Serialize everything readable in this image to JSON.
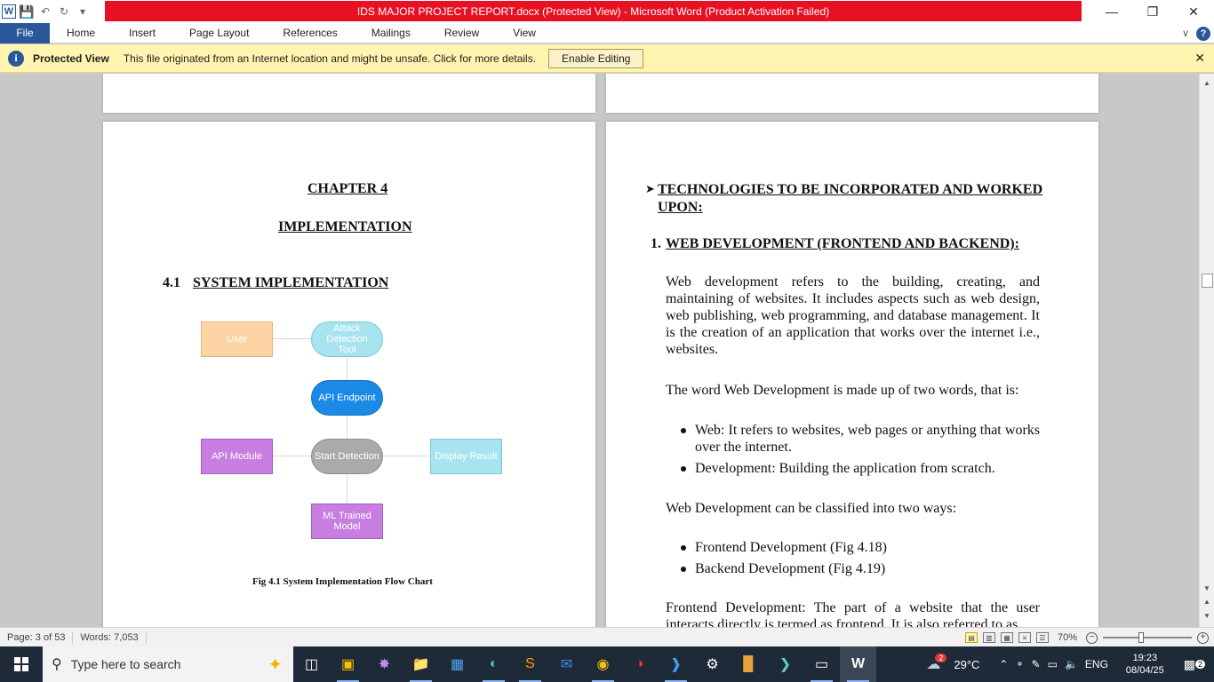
{
  "window": {
    "title": "IDS MAJOR PROJECT REPORT.docx (Protected View)  -  Microsoft Word (Product Activation Failed)"
  },
  "ribbon": {
    "tabs": [
      "File",
      "Home",
      "Insert",
      "Page Layout",
      "References",
      "Mailings",
      "Review",
      "View"
    ]
  },
  "protected_bar": {
    "label": "Protected View",
    "message": "This file originated from an Internet location and might be unsafe. Click for more details.",
    "button": "Enable Editing"
  },
  "page1": {
    "chapter": "CHAPTER 4",
    "title": "IMPLEMENTATION",
    "section_num": "4.1",
    "section_title": "SYSTEM IMPLEMENTATION",
    "flow": {
      "user": "User",
      "attack_tool": "Attack Detection Tool",
      "api_endpoint": "API Endpoint",
      "api_module": "API Module",
      "start_detection": "Start Detection",
      "display_result": "Display Result",
      "ml_model": "ML Trained Model"
    },
    "caption": "Fig 4.1 System Implementation Flow Chart"
  },
  "page2": {
    "heading": "TECHNOLOGIES TO BE INCORPORATED AND WORKED UPON:",
    "sub_num": "1.",
    "sub_heading": "WEB DEVELOPMENT (FRONTEND AND BACKEND):",
    "para1": "Web development refers to the building, creating, and maintaining of websites. It includes aspects such as web design, web publishing, web programming, and database management. It is the creation of an application that works over the internet i.e., websites.",
    "para2": "The word Web Development is made up of two words, that is:",
    "bullets1": [
      "Web: It refers to websites, web pages or anything that works over the internet.",
      "Development: Building the application from scratch."
    ],
    "para3": "Web Development can be classified into two ways:",
    "bullets2": [
      "Frontend Development (Fig 4.18)",
      "Backend Development (Fig 4.19)"
    ],
    "para4": "Frontend Development: The part of a website that the user interacts directly is termed as frontend. It is also referred to as"
  },
  "status": {
    "page": "Page: 3 of 53",
    "words": "Words: 7,053",
    "zoom": "70%"
  },
  "taskbar": {
    "search_placeholder": "Type here to search",
    "weather": "29°C",
    "weather_badge": "2",
    "lang": "ENG",
    "time": "19:23",
    "date": "08/04/25",
    "notif_count": "2"
  },
  "colors": {
    "title_red": "#e81123",
    "word_blue": "#2b579a",
    "msg_yellow": "#fff4b0",
    "user_box": "#fdd5a5",
    "attack_box": "#a8e4f0",
    "endpoint_box": "#1b8ae6",
    "module_box": "#c77ee0",
    "start_box": "#aaaaaa",
    "display_box": "#a8e4f0"
  }
}
